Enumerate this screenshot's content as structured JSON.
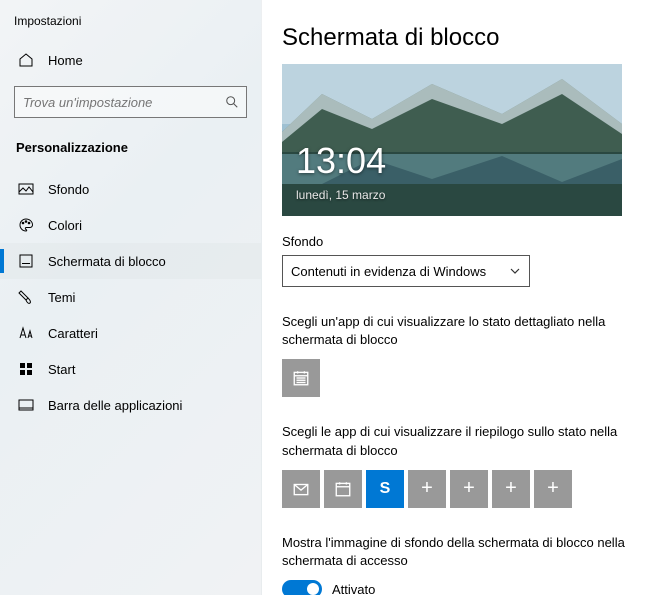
{
  "windowTitle": "Impostazioni",
  "home": "Home",
  "search": {
    "placeholder": "Trova un'impostazione"
  },
  "section": "Personalizzazione",
  "nav": {
    "background": "Sfondo",
    "colors": "Colori",
    "lockscreen": "Schermata di blocco",
    "themes": "Temi",
    "fonts": "Caratteri",
    "start": "Start",
    "taskbar": "Barra delle applicazioni"
  },
  "page": {
    "title": "Schermata di blocco",
    "clock": "13:04",
    "date": "lunedì, 15 marzo",
    "bgLabel": "Sfondo",
    "bgValue": "Contenuti in evidenza di Windows",
    "detailLabel": "Scegli un'app di cui visualizzare lo stato dettagliato nella schermata di blocco",
    "quickLabel": "Scegli le app di cui visualizzare il riepilogo sullo stato nella schermata di blocco",
    "signinLabel": "Mostra l'immagine di sfondo della schermata di blocco nella schermata di accesso",
    "toggleState": "Attivato"
  }
}
